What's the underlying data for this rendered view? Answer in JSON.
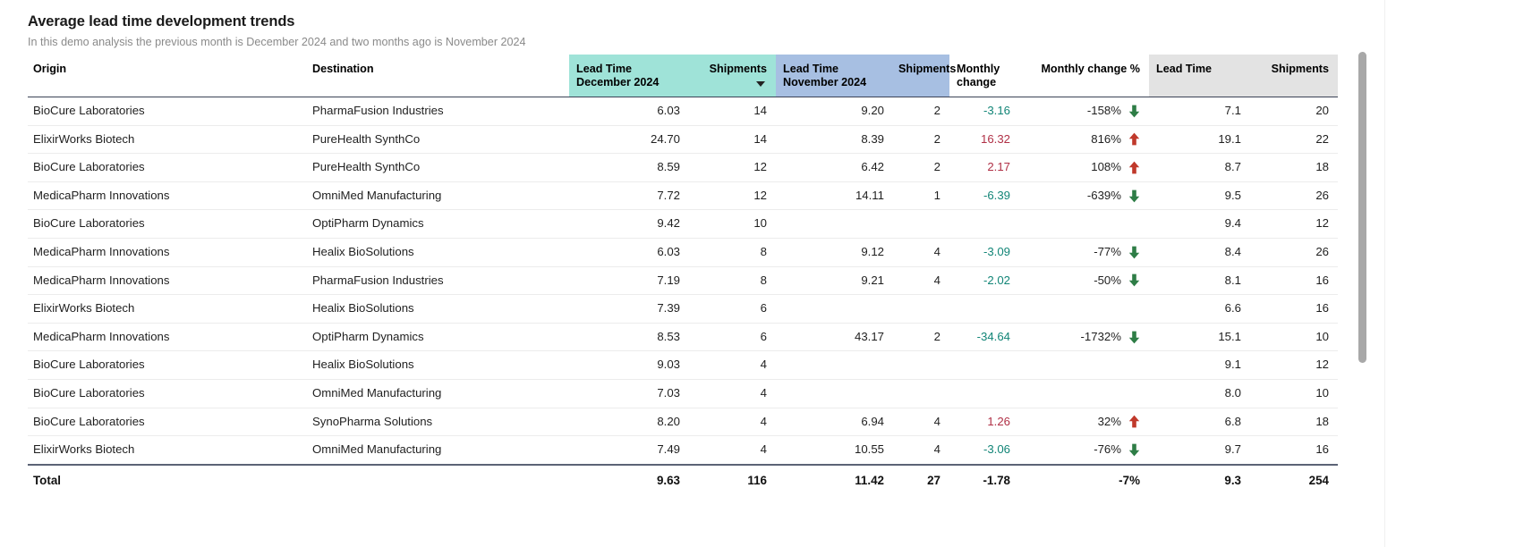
{
  "header": {
    "title": "Average lead time development trends",
    "subtitle": "In this demo analysis the previous month is December 2024 and two months ago is November 2024"
  },
  "colors": {
    "group_recent_month": "#9fe3d8",
    "group_previous_month": "#a7bfe2",
    "group_total": "#e3e3e3",
    "negative_change": "#128577",
    "positive_change": "#b03046",
    "arrow_down": "#2e7d46",
    "arrow_up": "#c0392b",
    "header_rule": "#3b4256",
    "total_rule": "#5b6375"
  },
  "columns": {
    "origin": "Origin",
    "destination": "Destination",
    "lead_time_december_line1": "Lead Time",
    "lead_time_december_line2": "December 2024",
    "shipments_december": "Shipments",
    "lead_time_november_line1": "Lead Time",
    "lead_time_november_line2": "November 2024",
    "shipments_november": "Shipments",
    "monthly_change_line1": "Monthly",
    "monthly_change_line2": "change",
    "monthly_change_pct": "Monthly change %",
    "lead_time_total": "Lead Time",
    "shipments_total": "Shipments"
  },
  "sort": {
    "column": "shipments_december",
    "direction": "desc"
  },
  "rows": [
    {
      "origin": "BioCure Laboratories",
      "destination": "PharmaFusion Industries",
      "lead_time_dec": "6.03",
      "shipments_dec": "14",
      "lead_time_nov": "9.20",
      "shipments_nov": "2",
      "monthly_change": "-3.16",
      "monthly_change_sign": "neg",
      "monthly_change_pct": "-158%",
      "arrow": "down",
      "lead_time_total": "7.1",
      "shipments_total": "20"
    },
    {
      "origin": "ElixirWorks Biotech",
      "destination": "PureHealth SynthCo",
      "lead_time_dec": "24.70",
      "shipments_dec": "14",
      "lead_time_nov": "8.39",
      "shipments_nov": "2",
      "monthly_change": "16.32",
      "monthly_change_sign": "pos",
      "monthly_change_pct": "816%",
      "arrow": "up",
      "lead_time_total": "19.1",
      "shipments_total": "22"
    },
    {
      "origin": "BioCure Laboratories",
      "destination": "PureHealth SynthCo",
      "lead_time_dec": "8.59",
      "shipments_dec": "12",
      "lead_time_nov": "6.42",
      "shipments_nov": "2",
      "monthly_change": "2.17",
      "monthly_change_sign": "pos",
      "monthly_change_pct": "108%",
      "arrow": "up",
      "lead_time_total": "8.7",
      "shipments_total": "18"
    },
    {
      "origin": "MedicaPharm Innovations",
      "destination": "OmniMed Manufacturing",
      "lead_time_dec": "7.72",
      "shipments_dec": "12",
      "lead_time_nov": "14.11",
      "shipments_nov": "1",
      "monthly_change": "-6.39",
      "monthly_change_sign": "neg",
      "monthly_change_pct": "-639%",
      "arrow": "down",
      "lead_time_total": "9.5",
      "shipments_total": "26"
    },
    {
      "origin": "BioCure Laboratories",
      "destination": "OptiPharm Dynamics",
      "lead_time_dec": "9.42",
      "shipments_dec": "10",
      "lead_time_nov": "",
      "shipments_nov": "",
      "monthly_change": "",
      "monthly_change_sign": "none",
      "monthly_change_pct": "",
      "arrow": "none",
      "lead_time_total": "9.4",
      "shipments_total": "12"
    },
    {
      "origin": "MedicaPharm Innovations",
      "destination": "Healix BioSolutions",
      "lead_time_dec": "6.03",
      "shipments_dec": "8",
      "lead_time_nov": "9.12",
      "shipments_nov": "4",
      "monthly_change": "-3.09",
      "monthly_change_sign": "neg",
      "monthly_change_pct": "-77%",
      "arrow": "down",
      "lead_time_total": "8.4",
      "shipments_total": "26"
    },
    {
      "origin": "MedicaPharm Innovations",
      "destination": "PharmaFusion Industries",
      "lead_time_dec": "7.19",
      "shipments_dec": "8",
      "lead_time_nov": "9.21",
      "shipments_nov": "4",
      "monthly_change": "-2.02",
      "monthly_change_sign": "neg",
      "monthly_change_pct": "-50%",
      "arrow": "down",
      "lead_time_total": "8.1",
      "shipments_total": "16"
    },
    {
      "origin": "ElixirWorks Biotech",
      "destination": "Healix BioSolutions",
      "lead_time_dec": "7.39",
      "shipments_dec": "6",
      "lead_time_nov": "",
      "shipments_nov": "",
      "monthly_change": "",
      "monthly_change_sign": "none",
      "monthly_change_pct": "",
      "arrow": "none",
      "lead_time_total": "6.6",
      "shipments_total": "16"
    },
    {
      "origin": "MedicaPharm Innovations",
      "destination": "OptiPharm Dynamics",
      "lead_time_dec": "8.53",
      "shipments_dec": "6",
      "lead_time_nov": "43.17",
      "shipments_nov": "2",
      "monthly_change": "-34.64",
      "monthly_change_sign": "neg",
      "monthly_change_pct": "-1732%",
      "arrow": "down",
      "lead_time_total": "15.1",
      "shipments_total": "10"
    },
    {
      "origin": "BioCure Laboratories",
      "destination": "Healix BioSolutions",
      "lead_time_dec": "9.03",
      "shipments_dec": "4",
      "lead_time_nov": "",
      "shipments_nov": "",
      "monthly_change": "",
      "monthly_change_sign": "none",
      "monthly_change_pct": "",
      "arrow": "none",
      "lead_time_total": "9.1",
      "shipments_total": "12"
    },
    {
      "origin": "BioCure Laboratories",
      "destination": "OmniMed Manufacturing",
      "lead_time_dec": "7.03",
      "shipments_dec": "4",
      "lead_time_nov": "",
      "shipments_nov": "",
      "monthly_change": "",
      "monthly_change_sign": "none",
      "monthly_change_pct": "",
      "arrow": "none",
      "lead_time_total": "8.0",
      "shipments_total": "10"
    },
    {
      "origin": "BioCure Laboratories",
      "destination": "SynoPharma Solutions",
      "lead_time_dec": "8.20",
      "shipments_dec": "4",
      "lead_time_nov": "6.94",
      "shipments_nov": "4",
      "monthly_change": "1.26",
      "monthly_change_sign": "pos",
      "monthly_change_pct": "32%",
      "arrow": "up",
      "lead_time_total": "6.8",
      "shipments_total": "18"
    },
    {
      "origin": "ElixirWorks Biotech",
      "destination": "OmniMed Manufacturing",
      "lead_time_dec": "7.49",
      "shipments_dec": "4",
      "lead_time_nov": "10.55",
      "shipments_nov": "4",
      "monthly_change": "-3.06",
      "monthly_change_sign": "neg",
      "monthly_change_pct": "-76%",
      "arrow": "down",
      "lead_time_total": "9.7",
      "shipments_total": "16"
    }
  ],
  "total": {
    "label": "Total",
    "destination": "",
    "lead_time_dec": "9.63",
    "shipments_dec": "116",
    "lead_time_nov": "11.42",
    "shipments_nov": "27",
    "monthly_change": "-1.78",
    "monthly_change_pct": "-7%",
    "lead_time_total": "9.3",
    "shipments_total": "254"
  }
}
